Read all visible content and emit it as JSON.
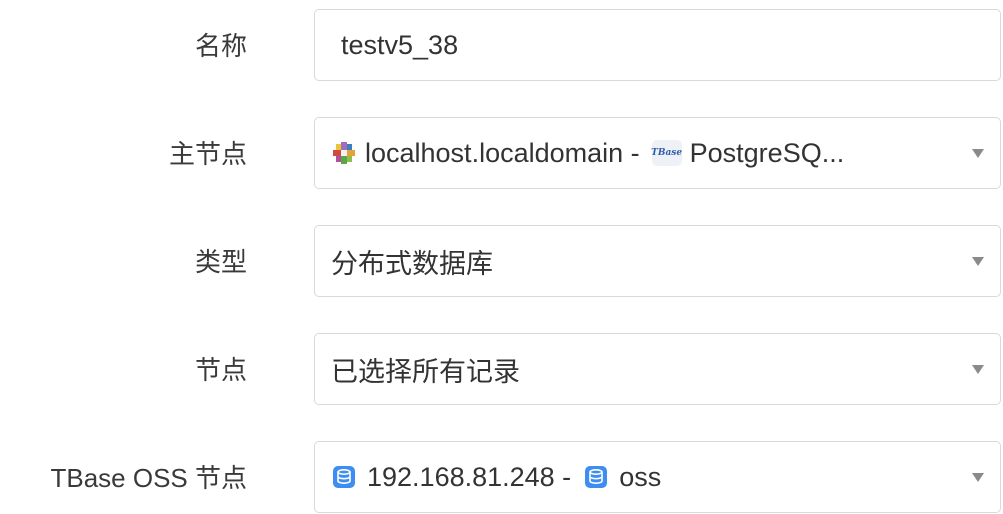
{
  "form": {
    "name": {
      "label": "名称",
      "value": "testv5_38"
    },
    "primary_node": {
      "label": "主节点",
      "host": "localhost.localdomain -",
      "product": "PostgreSQ..."
    },
    "type": {
      "label": "类型",
      "value": "分布式数据库"
    },
    "nodes": {
      "label": "节点",
      "value": "已选择所有记录"
    },
    "oss_node": {
      "label": "TBase OSS 节点",
      "ip": "192.168.81.248 -",
      "service": "oss"
    }
  },
  "icons": {
    "host": "pinwheel-host-icon",
    "tbase": "tbase-logo-icon",
    "tbase_text": "TBase",
    "database": "database-icon"
  },
  "colors": {
    "database_icon": "#3d8ef0",
    "border": "#d9d9d9",
    "caret": "#8a8a8a"
  }
}
